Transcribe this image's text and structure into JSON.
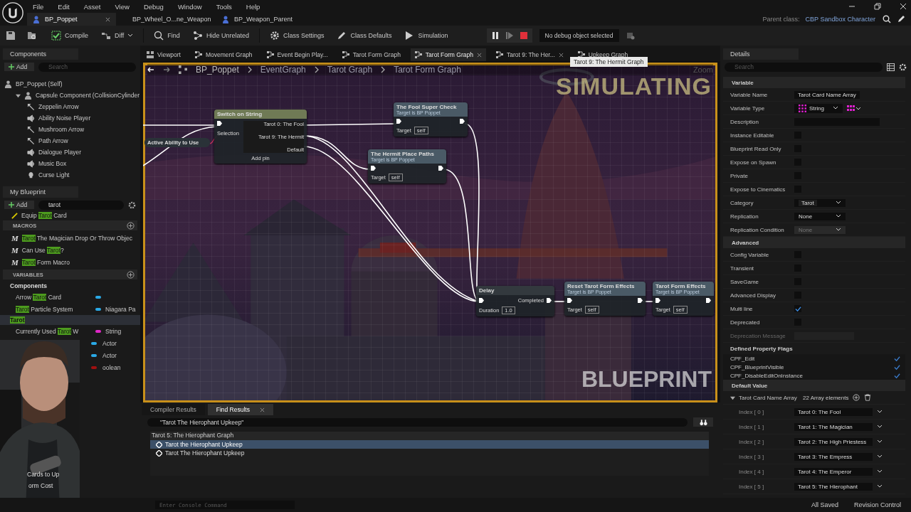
{
  "menu": [
    "File",
    "Edit",
    "Asset",
    "View",
    "Debug",
    "Window",
    "Tools",
    "Help"
  ],
  "document_tabs": [
    {
      "label": "BP_Poppet",
      "selected": true
    },
    {
      "label": "BP_Wheel_O...ne_Weapon",
      "selected": false
    },
    {
      "label": "BP_Weapon_Parent",
      "selected": false
    }
  ],
  "parent_class": {
    "label": "Parent class:",
    "value": "CBP Sandbox Character"
  },
  "toolbar": [
    {
      "label": "Compile",
      "kind": "compile"
    },
    {
      "label": "Diff",
      "kind": "diff"
    },
    {
      "label": "Find",
      "kind": "find"
    },
    {
      "label": "Hide Unrelated",
      "kind": "hide"
    },
    {
      "label": "Class Settings",
      "kind": "settings"
    },
    {
      "label": "Class Defaults",
      "kind": "defaults"
    },
    {
      "label": "Simulation",
      "kind": "simulation"
    }
  ],
  "debug_object": "No debug object selected",
  "components": {
    "title": "Components",
    "add": "Add",
    "search_placeholder": "Search",
    "tree": [
      {
        "label": "BP_Poppet (Self)",
        "kind": "actor",
        "children": [
          {
            "label": "Capsule Component (CollisionCylinder",
            "kind": "capsule",
            "expanded": true,
            "children": [
              {
                "label": "Zeppelin Arrow",
                "kind": "arrow"
              },
              {
                "label": "Ability Noise Player",
                "kind": "audio"
              },
              {
                "label": "Mushroom Arrow",
                "kind": "arrow"
              },
              {
                "label": "Path Arrow",
                "kind": "arrow"
              },
              {
                "label": "Dialogue Player",
                "kind": "audio"
              },
              {
                "label": "Music Box",
                "kind": "audio"
              },
              {
                "label": "Curse Light",
                "kind": "light"
              }
            ]
          }
        ]
      }
    ]
  },
  "my_blueprint": {
    "title": "My Blueprint",
    "add": "Add",
    "search": "tarot",
    "items": [
      {
        "kind": "function",
        "name": "Equip **Tarot** Card"
      },
      {
        "kind": "section",
        "name": "MACROS"
      },
      {
        "kind": "macro",
        "icon": "M",
        "name": "**Tarot** The Magician Drop Or Throw Objec"
      },
      {
        "kind": "macro",
        "icon": "M",
        "name": "Can Use **Tarot**?"
      },
      {
        "kind": "macro",
        "icon": "M",
        "name": "**Tarot** Form Macro"
      },
      {
        "kind": "section",
        "name": "VARIABLES"
      },
      {
        "kind": "category",
        "name": "Components",
        "highlighted": false
      },
      {
        "kind": "variable",
        "name": "Arrow **Tarot** Card",
        "color": "#2aa9e6"
      },
      {
        "kind": "variable",
        "name": "**Tarot** Particle System",
        "type": "Niagara Pa",
        "color": "#2aa9e6"
      },
      {
        "kind": "category",
        "name": "Tarot",
        "highlighted": true
      },
      {
        "kind": "variable",
        "name": "Currently Used **Tarot** W",
        "type": "String",
        "color": "#e028c8"
      },
      {
        "kind": "variable",
        "type": "Actor",
        "color": "#2aa9e6"
      },
      {
        "kind": "variable",
        "type": "Actor",
        "color": "#2aa9e6"
      },
      {
        "kind": "variable",
        "type": "oolean",
        "color": "#a01010"
      }
    ],
    "partly_hidden_names": [
      "Cards to Up",
      "orm Cost"
    ]
  },
  "graph_tabs": [
    {
      "label": "Viewport",
      "kind": "viewport",
      "selected": false,
      "closable": false
    },
    {
      "label": "Movement Graph",
      "kind": "graph",
      "selected": false,
      "closable": false
    },
    {
      "label": "Event Begin Play...",
      "kind": "graph",
      "selected": false,
      "closable": false
    },
    {
      "label": "Tarot Form Graph",
      "kind": "graph",
      "selected": false,
      "closable": false
    },
    {
      "label": "Tarot Form Graph",
      "kind": "graph",
      "selected": true,
      "closable": true
    },
    {
      "label": "Tarot 9: The Her...",
      "kind": "graph",
      "selected": false,
      "closable": true
    },
    {
      "label": "Upkeep Graph",
      "kind": "graph",
      "selected": false,
      "closable": false
    }
  ],
  "tooltip": "Tarot 9: The Hermit Graph",
  "breadcrumb": [
    "BP_Poppet",
    "EventGraph",
    "Tarot Graph",
    "Tarot Form Graph"
  ],
  "graph": {
    "zoom": "Zoom",
    "simulating_label": "SIMULATING",
    "watermark": "BLUEPRINT",
    "nodes": [
      {
        "kind": "switch",
        "title": "Switch on String",
        "inputs": [
          "Selection"
        ],
        "outputs": [
          "Tarot 0: The Fool",
          "Tarot 9: The Hermit",
          "Default"
        ],
        "add_pin": "Add pin"
      },
      {
        "kind": "variable",
        "title": "Active Ability to Use"
      },
      {
        "kind": "function",
        "title": "The Fool Super Check",
        "subtitle": "Target is BP Poppet",
        "target": "Target",
        "value": "self"
      },
      {
        "kind": "function",
        "title": "The Hermit Place Paths",
        "subtitle": "Target is BP Poppet",
        "target": "Target",
        "value": "self"
      },
      {
        "kind": "delay",
        "title": "Delay",
        "target": "Duration",
        "value": "1.0",
        "output": "Completed"
      },
      {
        "kind": "function",
        "title": "Reset Tarot Form Effects",
        "subtitle": "Target is BP Poppet",
        "target": "Target",
        "value": "self"
      },
      {
        "kind": "function",
        "title": "Tarot Form Effects",
        "subtitle": "Target is BP Poppet",
        "target": "Target",
        "value": "self"
      }
    ]
  },
  "bottom_tabs": [
    {
      "label": "Compiler Results",
      "selected": false,
      "closable": false
    },
    {
      "label": "Find Results",
      "selected": true,
      "closable": true
    }
  ],
  "find": {
    "query": "\"Tarot The Hierophant Upkeep\"",
    "group": "Tarot 5: The Hierophant Graph",
    "results": [
      {
        "label": "Tarot the Hierophant Upkeep",
        "selected": true
      },
      {
        "label": "Tarot The Hierophant Upkeep",
        "selected": false
      }
    ]
  },
  "console": {
    "placeholder": "Enter Console Command"
  },
  "details": {
    "title": "Details",
    "search_placeholder": "Search",
    "sections": [
      {
        "title": "Variable",
        "rows": [
          {
            "kind": "text",
            "label": "Variable Name",
            "value": "Tarot Card Name Array"
          },
          {
            "kind": "type",
            "label": "Variable Type",
            "value": "String"
          },
          {
            "kind": "text",
            "label": "Description"
          },
          {
            "kind": "checkbox",
            "label": "Instance Editable",
            "checked": false
          },
          {
            "kind": "checkbox",
            "label": "Blueprint Read Only",
            "checked": false
          },
          {
            "kind": "checkbox",
            "label": "Expose on Spawn",
            "checked": false
          },
          {
            "kind": "checkbox",
            "label": "Private",
            "checked": false
          },
          {
            "kind": "checkbox",
            "label": "Expose to Cinematics",
            "checked": false
          },
          {
            "kind": "combo",
            "label": "Category",
            "value": "Tarot"
          },
          {
            "kind": "dropdown",
            "label": "Replication",
            "value": "None",
            "disabled": false
          },
          {
            "kind": "dropdown",
            "label": "Replication Condition",
            "value": "None",
            "disabled": true
          }
        ]
      },
      {
        "title": "Advanced",
        "rows": [
          {
            "kind": "checkbox",
            "label": "Config Variable",
            "checked": false
          },
          {
            "kind": "checkbox",
            "label": "Transient",
            "checked": false
          },
          {
            "kind": "checkbox",
            "label": "SaveGame",
            "checked": false
          },
          {
            "kind": "checkbox",
            "label": "Advanced Display",
            "checked": false
          },
          {
            "kind": "checkbox",
            "label": "Multi line",
            "checked": true
          },
          {
            "kind": "checkbox",
            "label": "Deprecated",
            "checked": false
          },
          {
            "kind": "disabled_text",
            "label": "Deprecation Message"
          },
          {
            "kind": "flags",
            "label": "Defined Property Flags",
            "flags": [
              {
                "label": "CPF_Edit",
                "checked": true
              },
              {
                "label": "CPF_BlueprintVisible",
                "checked": true
              },
              {
                "label": "CPF_DisableEditOnInstance",
                "checked": true
              }
            ]
          }
        ]
      },
      {
        "title": "Default Value",
        "rows": [
          {
            "kind": "array",
            "label": "Tarot Card Name Array",
            "value": "22 Array elements",
            "elements": [
              {
                "label": "Index [ 0 ]",
                "value": "Tarot 0: The Fool"
              },
              {
                "label": "Index [ 1 ]",
                "value": "Tarot 1: The Magician"
              },
              {
                "label": "Index [ 2 ]",
                "value": "Tarot 2: The High Priestess"
              },
              {
                "label": "Index [ 3 ]",
                "value": "Tarot 3: The Empress"
              },
              {
                "label": "Index [ 4 ]",
                "value": "Tarot 4: The Emperor"
              },
              {
                "label": "Index [ 5 ]",
                "value": "Tarot 5: The Hierophant"
              }
            ]
          }
        ]
      }
    ]
  },
  "status": {
    "saved": "All Saved",
    "revision": "Revision Control"
  }
}
